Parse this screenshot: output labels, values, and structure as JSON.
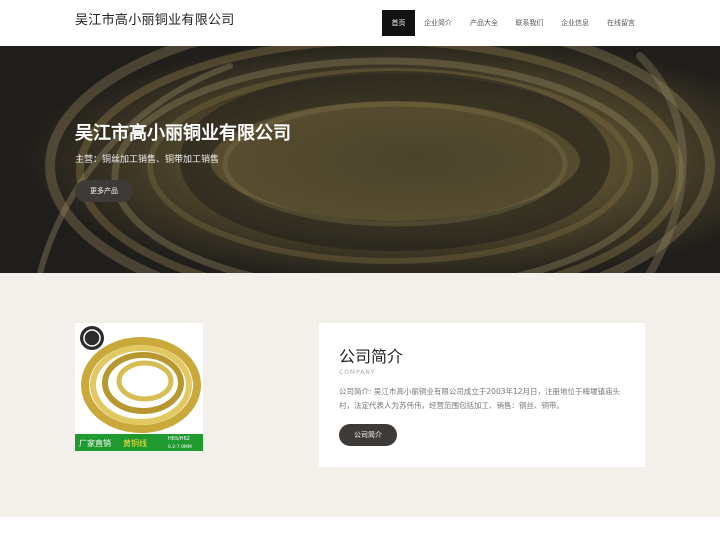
{
  "header": {
    "logo": "吴江市高小丽铜业有限公司",
    "nav": [
      "首页",
      "企业简介",
      "产品大全",
      "联系我们",
      "企业信息",
      "在线留言"
    ]
  },
  "hero": {
    "title": "吴江市高小丽铜业有限公司",
    "subtitle": "主营：铜丝加工销售、铜带加工销售",
    "button": "更多产品"
  },
  "about": {
    "title": "公司简介",
    "subtitle": "COMPANY",
    "text": "公司简介: 吴江市高小丽铜业有限公司成立于2003年12月日，注册地位于梅堰镇庙头村，法定代表人为苏伟伟，经营范围包括加工、销售：铜丝、铜带。",
    "button": "公司简介"
  },
  "product_image": {
    "banner_left": "厂家直销",
    "banner_right": "黄铜线",
    "spec_top": "H65/H62",
    "spec_bottom": "0.2-7.0MM"
  },
  "colors": {
    "header_bg": "#ffffff",
    "nav_active_bg": "#111111",
    "button_bg": "#3d3a37",
    "section_bg": "#f3f0eb",
    "banner_green": "#1f9a2e"
  }
}
